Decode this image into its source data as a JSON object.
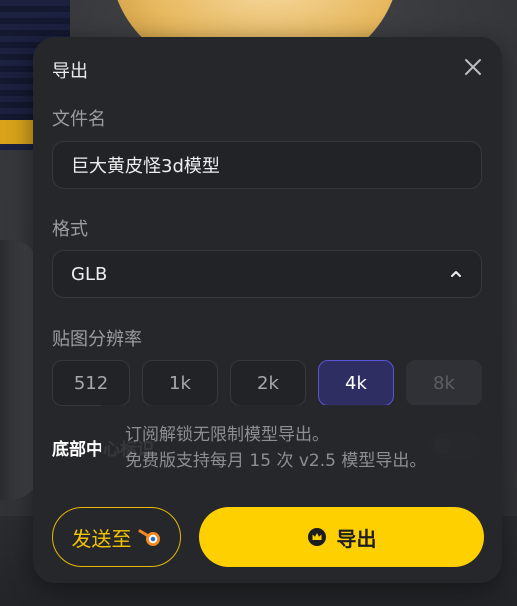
{
  "dialog": {
    "title": "导出",
    "filename_label": "文件名",
    "filename_value": "巨大黄皮怪3d模型",
    "format_label": "格式",
    "format_value": "GLB",
    "resolution_label": "贴图分辨率",
    "resolutions": [
      {
        "label": "512",
        "state": "normal"
      },
      {
        "label": "1k",
        "state": "normal"
      },
      {
        "label": "2k",
        "state": "normal"
      },
      {
        "label": "4k",
        "state": "selected"
      },
      {
        "label": "8k",
        "state": "disabled"
      }
    ],
    "watermark_label": "底部中心标识",
    "watermark_toggle_on": false,
    "tooltip_line1": "订阅解锁无限制模型导出。",
    "tooltip_line2": "免费版支持每月 15 次 v2.5 模型导出。",
    "send_to_label": "发送至",
    "send_to_icon": "blender-icon",
    "export_label": "导出",
    "export_icon": "crown-icon"
  },
  "colors": {
    "panel_bg": "#26272b",
    "accent_yellow": "#fed000",
    "selected_purple": "#2f2e63",
    "selected_border": "#5a54d6"
  }
}
